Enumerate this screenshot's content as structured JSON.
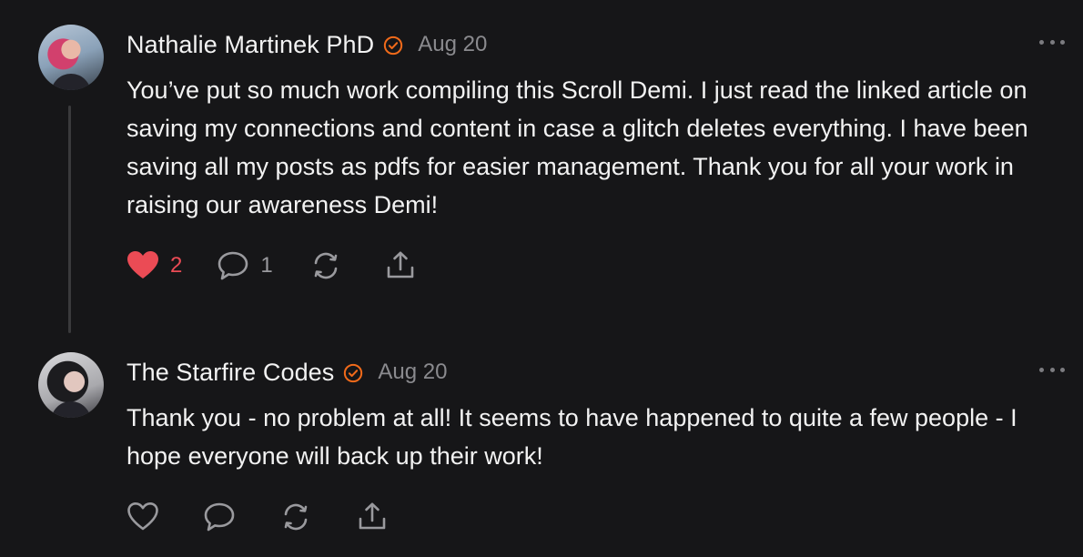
{
  "comments": [
    {
      "author": "Nathalie Martinek PhD",
      "date": "Aug 20",
      "text": "You’ve put so much work compiling this Scroll Demi. I just read the linked article on saving my connections and content in case a glitch deletes everything. I have been saving all my posts as pdfs for easier management. Thank you for all your work in raising our awareness Demi!",
      "likes": "2",
      "replies": "1",
      "liked": true
    },
    {
      "author": "The Starfire Codes",
      "date": "Aug 20",
      "text": "Thank you - no problem at all! It seems to have happened to quite a few people - I hope everyone will back up their work!",
      "liked": false
    }
  ],
  "icons": {
    "verified": "verified-badge-icon",
    "heart": "heart-icon",
    "reply": "reply-bubble-icon",
    "restack": "restack-icon",
    "share": "share-icon",
    "more": "more-options-icon"
  },
  "colors": {
    "background": "#161618",
    "accent": "#F06A1A",
    "like_red": "#EB4B55",
    "muted": "#8A8A8E"
  }
}
